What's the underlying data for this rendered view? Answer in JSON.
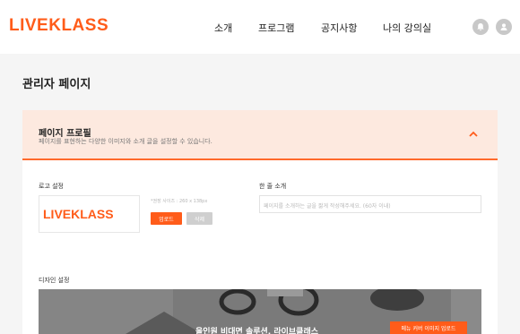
{
  "header": {
    "logo": "LIVEKLASS",
    "nav": [
      "소개",
      "프로그램",
      "공지사항",
      "나의 강의실"
    ]
  },
  "colors": {
    "accent": "#ff5c1a",
    "header_bg": "#fde9df"
  },
  "icons": {
    "bell": "bell-icon",
    "user": "user-icon",
    "chevron": "chevron-up-icon"
  },
  "page": {
    "title": "관리자 페이지"
  },
  "profile": {
    "title": "페이지 프로필",
    "subtitle": "페이지를 표현하는 다양한 이미지와 소개 글을 설정할 수 있습니다."
  },
  "logo_setting": {
    "label": "로고 설정",
    "preview_text": "LIVEKLASS",
    "hint": "*권장 사이즈 : 260 x 138px",
    "upload_label": "업로드",
    "delete_label": "삭제"
  },
  "intro": {
    "label": "한 줄 소개",
    "placeholder": "페이지를 소개하는 글을 짧게 작성해주세요. (60자 이내)"
  },
  "design": {
    "label": "디자인 설정",
    "banner_text": "올인원 비대면 솔루션, 라이브클래스",
    "cover_upload_label": "메뉴 커버 이미지 업로드"
  }
}
